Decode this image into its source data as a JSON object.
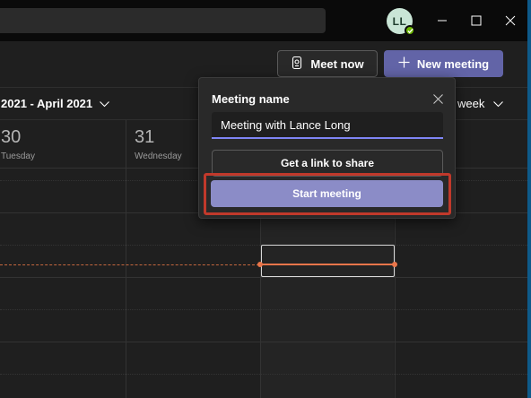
{
  "title_bar": {
    "avatar_initials": "LL",
    "presence_status": "available",
    "window_controls": [
      "minimize",
      "maximize",
      "close"
    ]
  },
  "header": {
    "meet_now_label": "Meet now",
    "new_meeting_label": "New meeting"
  },
  "calendar": {
    "date_range": "2021 - April 2021",
    "view_label": "week",
    "days": [
      {
        "number": "30",
        "name": "Tuesday"
      },
      {
        "number": "31",
        "name": "Wednesday"
      }
    ]
  },
  "meet_now_popup": {
    "title": "Meeting name",
    "meeting_name_value": "Meeting with Lance Long",
    "link_button_label": "Get a link to share",
    "start_button_label": "Start meeting"
  },
  "colors": {
    "accent": "#6264a7",
    "start_button": "#8b8cc7",
    "current_time_line": "#e9754a",
    "highlight_outline": "#c1392b",
    "window_border": "#0e5a8a"
  }
}
